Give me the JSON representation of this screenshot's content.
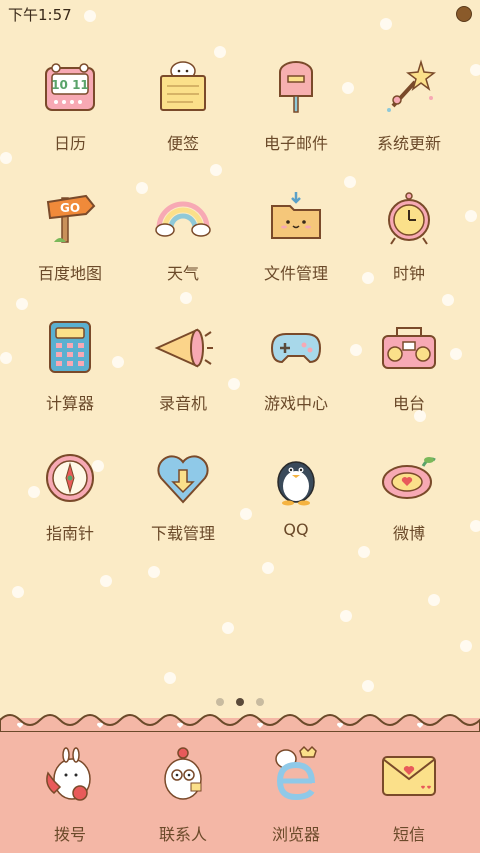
{
  "status_bar": {
    "time": "下午1:57"
  },
  "apps": [
    {
      "label": "日历",
      "icon": "calendar-icon"
    },
    {
      "label": "便签",
      "icon": "notes-icon"
    },
    {
      "label": "电子邮件",
      "icon": "mailbox-icon"
    },
    {
      "label": "系统更新",
      "icon": "magic-wand-icon"
    },
    {
      "label": "百度地图",
      "icon": "signpost-icon"
    },
    {
      "label": "天气",
      "icon": "rainbow-icon"
    },
    {
      "label": "文件管理",
      "icon": "folder-icon"
    },
    {
      "label": "时钟",
      "icon": "alarm-clock-icon"
    },
    {
      "label": "计算器",
      "icon": "calculator-icon"
    },
    {
      "label": "录音机",
      "icon": "megaphone-icon"
    },
    {
      "label": "游戏中心",
      "icon": "gamepad-icon"
    },
    {
      "label": "电台",
      "icon": "radio-icon"
    },
    {
      "label": "指南针",
      "icon": "compass-icon"
    },
    {
      "label": "下载管理",
      "icon": "heart-download-icon"
    },
    {
      "label": "QQ",
      "icon": "penguin-icon"
    },
    {
      "label": "微博",
      "icon": "weibo-icon"
    }
  ],
  "calendar_date": "10 11",
  "signpost_text": "GO",
  "pager": {
    "pages": 3,
    "active": 2
  },
  "dock": [
    {
      "label": "拨号",
      "icon": "phone-icon"
    },
    {
      "label": "联系人",
      "icon": "contacts-icon"
    },
    {
      "label": "浏览器",
      "icon": "browser-icon"
    },
    {
      "label": "短信",
      "icon": "envelope-icon"
    }
  ],
  "colors": {
    "background": "#fbebc6",
    "dock": "#f4b7a6",
    "label": "#6b4a2a"
  }
}
